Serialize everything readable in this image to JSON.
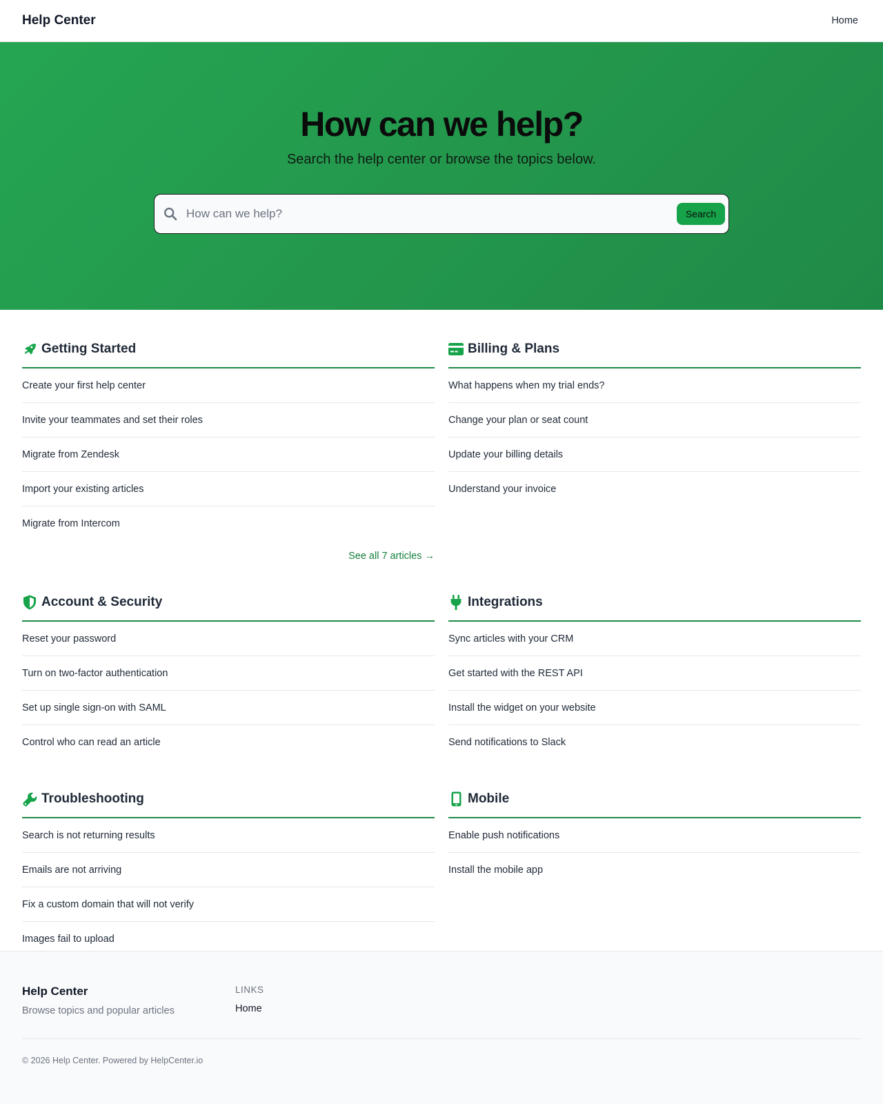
{
  "header": {
    "brand": "Help Center",
    "nav": [
      {
        "label": "Home"
      }
    ]
  },
  "hero": {
    "title": "How can we help?",
    "subtitle": "Search the help center or browse the topics below.",
    "search": {
      "placeholder": "How can we help?",
      "value": "",
      "button_label": "Search",
      "icon": "search-icon"
    }
  },
  "categories": [
    {
      "title": "Getting Started",
      "icon": "rocket-icon",
      "articles": [
        "Create your first help center",
        "Invite your teammates and set their roles",
        "Migrate from Zendesk",
        "Import your existing articles",
        "Migrate from Intercom"
      ],
      "see_all": "See all 7 articles →"
    },
    {
      "title": "Billing & Plans",
      "icon": "credit-card-icon",
      "articles": [
        "What happens when my trial ends?",
        "Change your plan or seat count",
        "Update your billing details",
        "Understand your invoice"
      ]
    },
    {
      "title": "Account & Security",
      "icon": "shield-icon",
      "articles": [
        "Reset your password",
        "Turn on two-factor authentication",
        "Set up single sign-on with SAML",
        "Control who can read an article"
      ]
    },
    {
      "title": "Integrations",
      "icon": "plug-icon",
      "articles": [
        "Sync articles with your CRM",
        "Get started with the REST API",
        "Install the widget on your website",
        "Send notifications to Slack"
      ]
    },
    {
      "title": "Troubleshooting",
      "icon": "wrench-icon",
      "articles": [
        "Search is not returning results",
        "Emails are not arriving",
        "Fix a custom domain that will not verify",
        "Images fail to upload"
      ]
    },
    {
      "title": "Mobile",
      "icon": "mobile-icon",
      "articles": [
        "Enable push notifications",
        "Install the mobile app"
      ]
    }
  ],
  "footer": {
    "brand": "Help Center",
    "tagline": "Browse topics and popular articles",
    "links_heading": "LINKS",
    "links": [
      {
        "label": "Home"
      }
    ],
    "copyright": "© 2026 Help Center. Powered by HelpCenter.io"
  },
  "colors": {
    "accent": "#16a34a",
    "hero_gradient_start": "#25a552",
    "hero_gradient_end": "#1f8a47",
    "link": "#15803d"
  }
}
